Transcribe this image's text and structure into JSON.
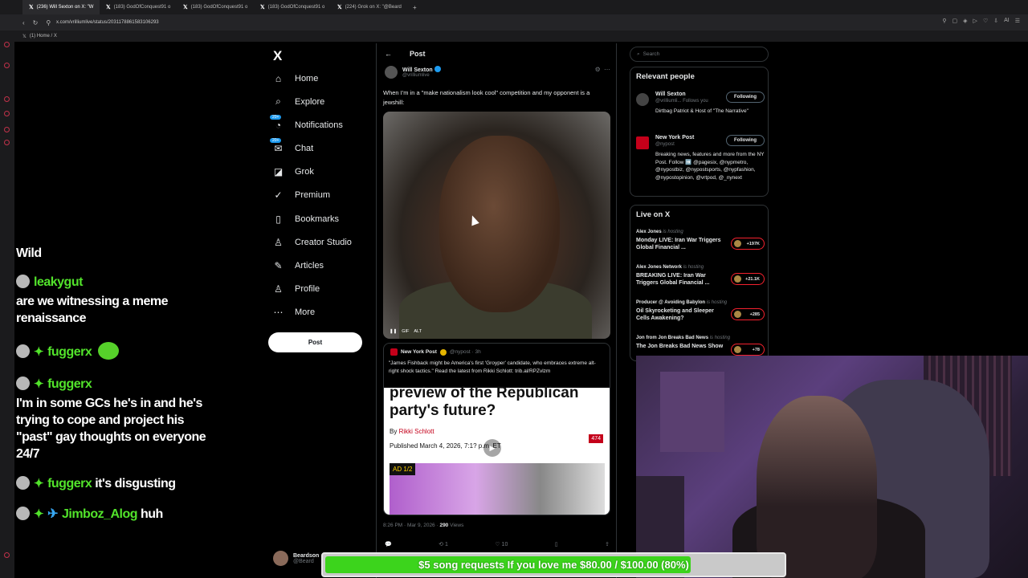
{
  "browser": {
    "tabs": [
      {
        "label": "(236) Will Sexton on X: \"W",
        "active": true
      },
      {
        "label": "(183) GodOfConquest91 o",
        "active": false
      },
      {
        "label": "(183) GodOfConquest91 o",
        "active": false
      },
      {
        "label": "(183) GodOfConquest91 o",
        "active": false
      },
      {
        "label": "(224) Grok on X: \"@Beard",
        "active": false
      }
    ],
    "new_tab": "+",
    "url": "x.com/vrilliumlive/status/2031178861583106293",
    "bookmark": "(1) Home / X"
  },
  "x_nav": {
    "logo": "X",
    "items": [
      {
        "label": "Home",
        "icon": "home-icon",
        "glyph": "⌂"
      },
      {
        "label": "Explore",
        "icon": "search-icon",
        "glyph": "⌕"
      },
      {
        "label": "Notifications",
        "icon": "bell-icon",
        "glyph": "🔔",
        "badge": "20+"
      },
      {
        "label": "Chat",
        "icon": "mail-icon",
        "glyph": "✉",
        "badge": "20+"
      },
      {
        "label": "Grok",
        "icon": "grok-icon",
        "glyph": "◪"
      },
      {
        "label": "Premium",
        "icon": "premium-icon",
        "glyph": "✓"
      },
      {
        "label": "Bookmarks",
        "icon": "bookmark-icon",
        "glyph": "▯"
      },
      {
        "label": "Creator Studio",
        "icon": "creator-icon",
        "glyph": "♙"
      },
      {
        "label": "Articles",
        "icon": "articles-icon",
        "glyph": "✎"
      },
      {
        "label": "Profile",
        "icon": "profile-icon",
        "glyph": "♙"
      },
      {
        "label": "More",
        "icon": "more-icon",
        "glyph": "⋯"
      }
    ],
    "post_button": "Post",
    "account_name": "Beardson",
    "account_handle": "@Beard"
  },
  "post": {
    "header": "Post",
    "author_name": "Will Sexton",
    "author_handle": "@vrilliumlive",
    "text": "When I'm in a \"make nationalism look cool\" competition and my opponent is a jewshill:",
    "media_controls": [
      "❚❚",
      "GIF",
      "ALT"
    ],
    "quote": {
      "source": "New York Post",
      "handle": "@nypost · 3h",
      "text": "\"James Fishback might be America's first 'Groyper' candidate, who embraces extreme alt-right shock tactics.\" Read the latest from Rikki Schlott: trib.al/RPZvlzm",
      "headline": "preview of the Republican party's future?",
      "byline_prefix": "By",
      "byline_author": "Rikki Schlott",
      "published": "Published March 4, 2026, 7:1? p.m. ET",
      "count": "474",
      "ad": "AD  1/2"
    },
    "timestamp": "8:26 PM · Mar 9, 2026 ·",
    "views": "290",
    "views_label": "Views",
    "actions": [
      "💬",
      "⟲ 1",
      "♡ 10",
      "▯",
      "⇪"
    ]
  },
  "sidebar": {
    "search_placeholder": "Search",
    "relevant_title": "Relevant people",
    "people": [
      {
        "name": "Will Sexton",
        "handle": "@vrilliumli... Follows you",
        "bio": "Dirtbag Patriot & Host of \"The Narrative\"",
        "button": "Following"
      },
      {
        "name": "New York Post",
        "handle": "@nypost",
        "bio": "Breaking news, features and more from the NY Post. Follow ➡️ @pagesix, @nypmetro, @nypostbiz, @nypostsports, @nypfashion, @nypostopinion, @vrtpod, @_nynext",
        "button": "Following"
      }
    ],
    "live_title": "Live on X",
    "live": [
      {
        "host": "Alex Jones",
        "status": "is hosting",
        "title": "Monday LIVE: Iran War Triggers Global Financial ...",
        "count": "+197K"
      },
      {
        "host": "Alex Jones Network",
        "status": "is hosting",
        "title": "BREAKING LIVE: Iran War Triggers Global Financial ...",
        "count": "+21.1K"
      },
      {
        "host": "Producer @ Avoiding Babylon",
        "status": "is hosting",
        "title": "Oil Skyrocketing and Sleeper Cells Awakening?",
        "count": "+285"
      },
      {
        "host": "Jon from Jon Breaks Bad News",
        "status": "is hosting",
        "title": "The Jon Breaks Bad News Show",
        "count": "+78"
      }
    ]
  },
  "stream_chat": {
    "messages": [
      {
        "user": "",
        "text": "Wild"
      },
      {
        "user": "leakygut",
        "text": "are we witnessing a meme renaissance"
      },
      {
        "user": "fuggerx",
        "text": ""
      },
      {
        "user": "fuggerx",
        "text": "I'm in some GCs he's in and he's trying to cope and project his \"past\" gay thoughts on everyone 24/7"
      },
      {
        "user": "fuggerx",
        "text": "it's disgusting"
      },
      {
        "user": "Jimboz_Alog",
        "text": "huh"
      }
    ]
  },
  "donation_bar": {
    "text": "$5 song requests If you love me $80.00 / $100.00 (80%)",
    "progress": 0.8
  }
}
